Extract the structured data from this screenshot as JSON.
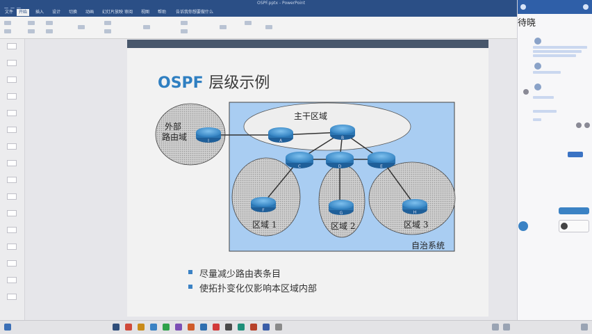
{
  "window": {
    "title": "OSPF.pptx - PowerPoint"
  },
  "ribbon": {
    "tabs": [
      "文件",
      "开始",
      "插入",
      "设计",
      "切换",
      "动画",
      "幻灯片放映",
      "审阅",
      "视图",
      "帮助",
      "告诉我你想要做什么"
    ]
  },
  "slide": {
    "title_en": "OSPF",
    "title_cn": "层级示例",
    "external_domain": [
      "外部",
      "路由域"
    ],
    "backbone_label": "主干区域",
    "area1_label": "区域 1",
    "area2_label": "区域 2",
    "area3_label": "区域 3",
    "as_label": "自治系统",
    "routers": [
      "I",
      "A",
      "B",
      "C",
      "D",
      "E",
      "F",
      "G",
      "H"
    ],
    "bullets": [
      "尽量减少路由表条目",
      "使拓扑变化仅影响本区域内部"
    ]
  },
  "chat": {
    "watermark": "待晓"
  },
  "colors": {
    "title_blue": "#2f7fc1",
    "as_fill": "#a9cdf2",
    "router_blue": "#3a8ec9",
    "bullet_blue": "#3b82c4",
    "ribbon_blue": "#2b4f86"
  }
}
